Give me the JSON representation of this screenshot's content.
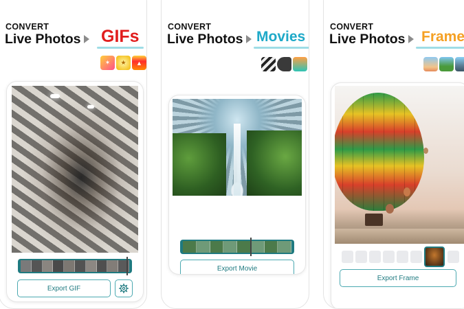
{
  "panels": [
    {
      "convert_label": "CONVERT",
      "source_label": "Live Photos",
      "target_label": "GIFs",
      "target_color": "#e11d1d",
      "emojis": [
        "party-popper-emoji",
        "dizzy-emoji",
        "fire-emoji"
      ],
      "export_label": "Export GIF"
    },
    {
      "convert_label": "CONVERT",
      "source_label": "Live Photos",
      "target_label": "Movies",
      "target_color": "#1ea9c8",
      "emojis": [
        "clapperboard-emoji",
        "movie-camera-emoji",
        "mermaid-emoji"
      ],
      "export_label": "Export Movie"
    },
    {
      "convert_label": "CONVERT",
      "source_label": "Live Photos",
      "target_label": "Frame",
      "target_color": "#f5a023",
      "emojis": [
        "sunrise-emoji",
        "national-park-emoji",
        "cityscape-emoji"
      ],
      "export_label": "Export Frame"
    }
  ],
  "colors": {
    "accent_teal": "#1f7a80",
    "button_border": "#4aa8b0",
    "underline": "#9fdde6"
  },
  "icons": {
    "arrow": "triangle-right-icon",
    "settings": "gear-icon"
  }
}
